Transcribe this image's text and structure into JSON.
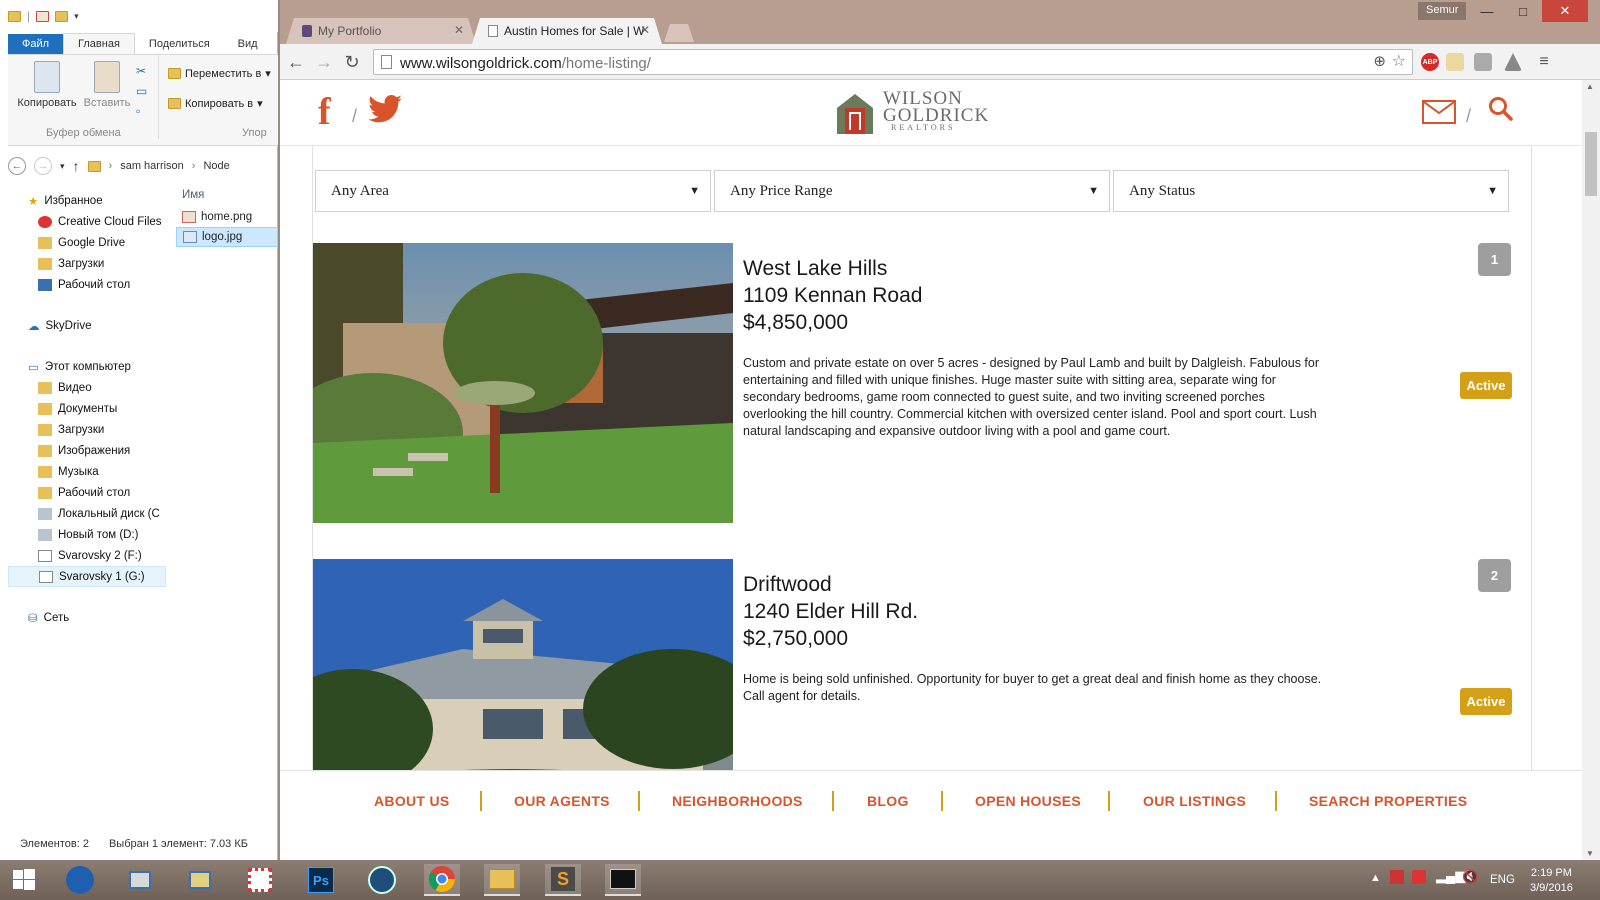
{
  "explorer": {
    "ribbon_tabs": [
      "Файл",
      "Главная",
      "Поделиться",
      "Вид"
    ],
    "ribbon": {
      "copy": "Копировать",
      "paste": "Вставить",
      "move_to": "Переместить в",
      "copy_to": "Копировать в",
      "group_clipboard": "Буфер обмена",
      "group_organize": "Упор"
    },
    "address": [
      "sam harrison",
      "Node"
    ],
    "nav": {
      "favorites": "Избранное",
      "fav_items": [
        "Creative Cloud Files",
        "Google Drive",
        "Загрузки",
        "Рабочий стол"
      ],
      "skydrive": "SkyDrive",
      "this_pc": "Этот компьютер",
      "pc_items": [
        "Видео",
        "Документы",
        "Загрузки",
        "Изображения",
        "Музыка",
        "Рабочий стол",
        "Локальный диск (C",
        "Новый том (D:)",
        "Svarovsky 2 (F:)",
        "Svarovsky 1 (G:)"
      ],
      "network": "Сеть"
    },
    "file_header": "Имя",
    "files": [
      "home.png",
      "logo.jpg"
    ],
    "status_count": "Элементов: 2",
    "status_selected": "Выбран 1 элемент: 7.03 КБ"
  },
  "browser": {
    "user": "Semur",
    "tabs": [
      {
        "label": "My Portfolio"
      },
      {
        "label": "Austin Homes for Sale | W"
      }
    ],
    "url_host": "www.wilsongoldrick.com",
    "url_path": "/home-listing/",
    "ext_abp": "ABP"
  },
  "site": {
    "logo": {
      "line1": "WILSON",
      "line2": "GOLDRICK",
      "line3": "REALTORS"
    },
    "filters": [
      "Any Area",
      "Any Price Range",
      "Any Status"
    ],
    "listings": [
      {
        "number": "1",
        "area": "West Lake Hills",
        "address": "1109 Kennan Road",
        "price": "$4,850,000",
        "description": "Custom and private estate on over 5 acres - designed by Paul Lamb and built by Dalgleish. Fabulous for entertaining and filled with unique finishes. Huge master suite with sitting area, separate wing for secondary bedrooms, game room connected to guest suite, and two inviting screened porches overlooking the hill country. Commercial kitchen with oversized center island. Pool and sport court. Lush natural landscaping and expansive outdoor living with a pool and game court.",
        "status": "Active"
      },
      {
        "number": "2",
        "area": "Driftwood",
        "address": "1240 Elder Hill Rd.",
        "price": "$2,750,000",
        "description": "Home is being sold unfinished. Opportunity for buyer to get a great deal and finish home as they choose. Call agent for details.",
        "status": "Active"
      }
    ],
    "footer_nav": [
      "ABOUT US",
      "OUR AGENTS",
      "NEIGHBORHOODS",
      "BLOG",
      "OPEN HOUSES",
      "OUR LISTINGS",
      "SEARCH PROPERTIES"
    ],
    "colors": {
      "accent": "#d9542b",
      "gold": "#d4a017"
    }
  },
  "taskbar": {
    "lang": "ENG",
    "time": "2:19 PM",
    "date": "3/9/2016"
  }
}
